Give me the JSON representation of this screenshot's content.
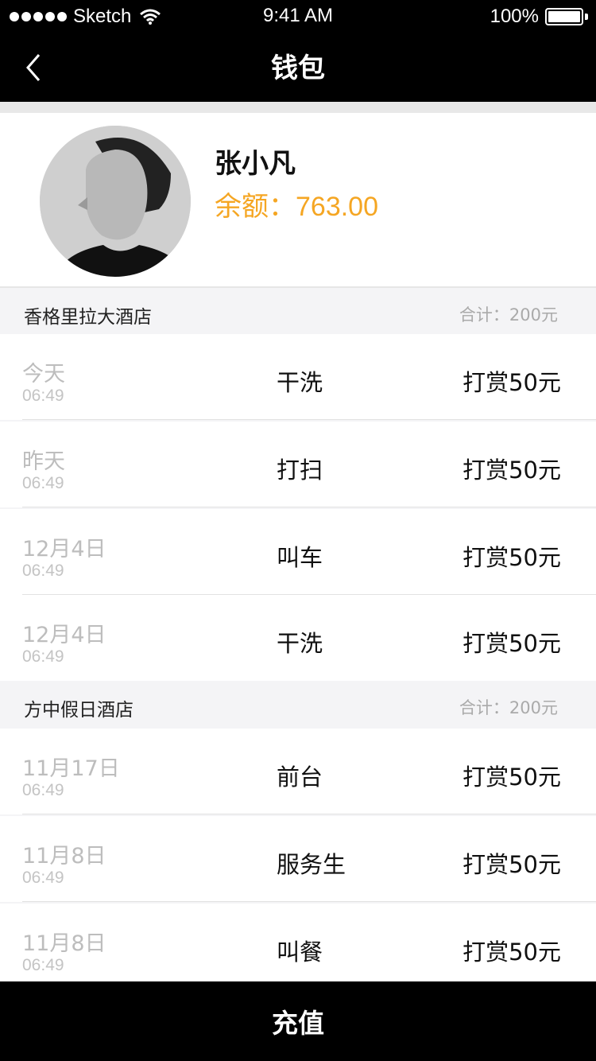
{
  "status_bar": {
    "carrier": "Sketch",
    "time": "9:41 AM",
    "battery": "100%",
    "battery_level": 1.0
  },
  "nav": {
    "title": "钱包",
    "back_icon": "chevron-left-icon"
  },
  "profile": {
    "name": "张小凡",
    "balance_label": "余额：",
    "balance_value": "763.00",
    "accent_color": "#f5a623"
  },
  "groups": [
    {
      "hotel": "香格里拉大酒店",
      "total": "合计：200元",
      "rows": [
        {
          "date": "今天",
          "time": "06:49",
          "service": "干洗",
          "reward": "打赏50元"
        },
        {
          "date": "昨天",
          "time": "06:49",
          "service": "打扫",
          "reward": "打赏50元"
        },
        {
          "date": "12月4日",
          "time": "06:49",
          "service": "叫车",
          "reward": "打赏50元"
        },
        {
          "date": "12月4日",
          "time": "06:49",
          "service": "干洗",
          "reward": "打赏50元"
        }
      ]
    },
    {
      "hotel": "方中假日酒店",
      "total": "合计：200元",
      "rows": [
        {
          "date": "11月17日",
          "time": "06:49",
          "service": "前台",
          "reward": "打赏50元"
        },
        {
          "date": "11月8日",
          "time": "06:49",
          "service": "服务生",
          "reward": "打赏50元"
        },
        {
          "date": "11月8日",
          "time": "06:49",
          "service": "叫餐",
          "reward": "打赏50元"
        }
      ]
    }
  ],
  "bottom_button": {
    "label": "充值"
  }
}
